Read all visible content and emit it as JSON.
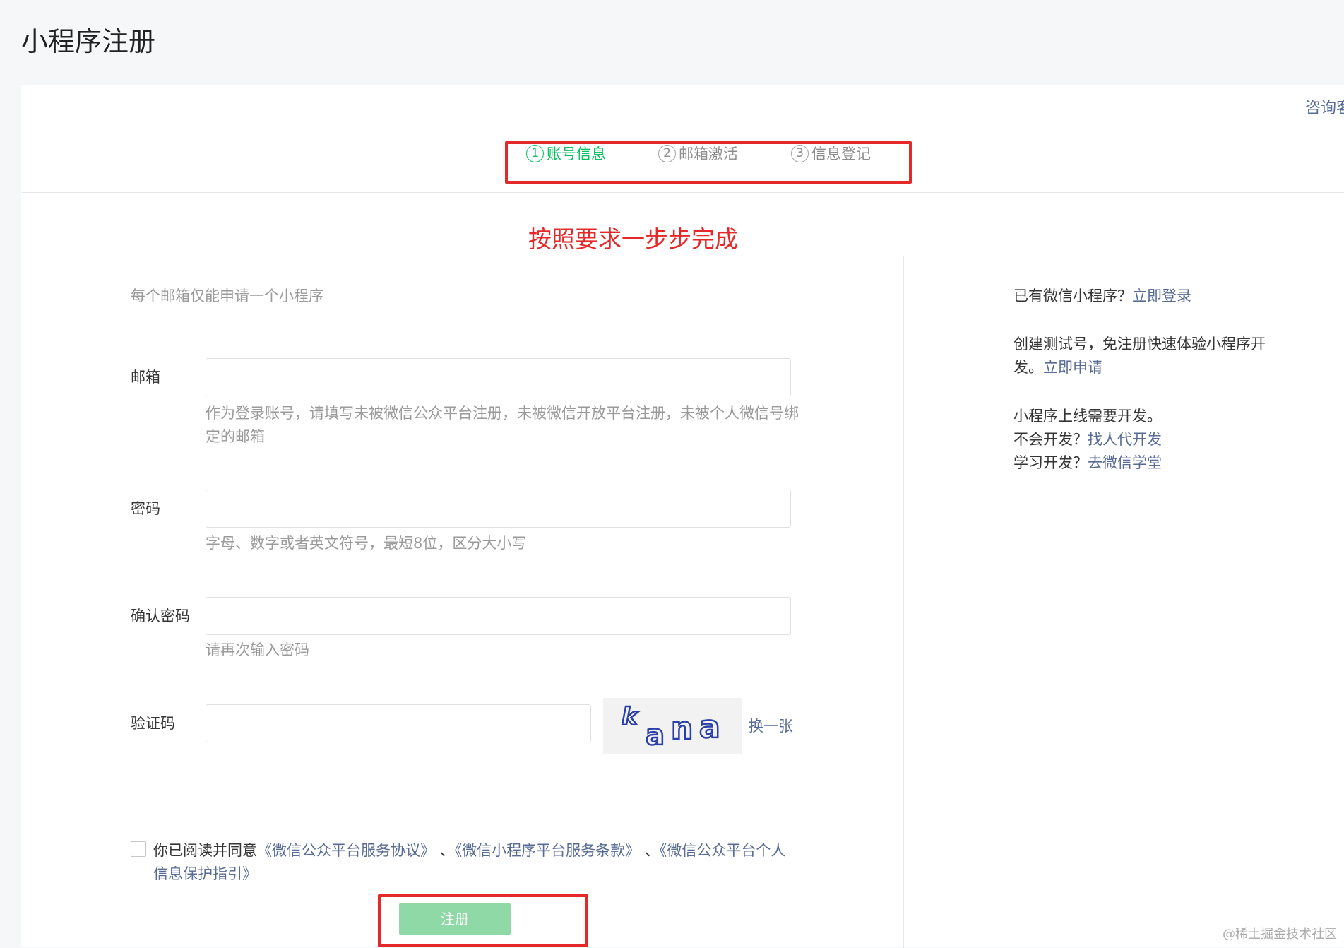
{
  "page_title": "小程序注册",
  "consult_link": "咨询客",
  "steps": [
    {
      "num": "1",
      "label": "账号信息",
      "active": true
    },
    {
      "num": "2",
      "label": "邮箱激活",
      "active": false
    },
    {
      "num": "3",
      "label": "信息登记",
      "active": false
    }
  ],
  "annotation_text": "按照要求一步步完成",
  "form": {
    "notice": "每个邮箱仅能申请一个小程序",
    "email": {
      "label": "邮箱",
      "value": "",
      "hint": "作为登录账号，请填写未被微信公众平台注册，未被微信开放平台注册，未被个人微信号绑定的邮箱"
    },
    "password": {
      "label": "密码",
      "value": "",
      "hint": "字母、数字或者英文符号，最短8位，区分大小写"
    },
    "confirm_password": {
      "label": "确认密码",
      "value": "",
      "hint": "请再次输入密码"
    },
    "captcha": {
      "label": "验证码",
      "value": "",
      "image_text": "kana",
      "swap_label": "换一张"
    },
    "agreement": {
      "prefix": "你已阅读并同意",
      "link1": "《微信公众平台服务协议》",
      "sep1": " 、",
      "link2": "《微信小程序平台服务条款》",
      "sep2": " 、",
      "link3": "《微信公众平台个人信息保护指引》"
    },
    "submit_label": "注册"
  },
  "sidebar": {
    "login_prompt": "已有微信小程序？",
    "login_link": "立即登录",
    "test_text": "创建测试号，免注册快速体验小程序开发。",
    "test_link": "立即申请",
    "dev_text": "小程序上线需要开发。",
    "dev_q1": "不会开发？",
    "dev_link1": "找人代开发",
    "dev_q2": "学习开发？",
    "dev_link2": "去微信学堂"
  },
  "watermark": "@稀土掘金技术社区",
  "colors": {
    "accent": "#07c160",
    "link": "#576b95",
    "annotation": "#e52828",
    "button_disabled": "#8ed9a6"
  }
}
